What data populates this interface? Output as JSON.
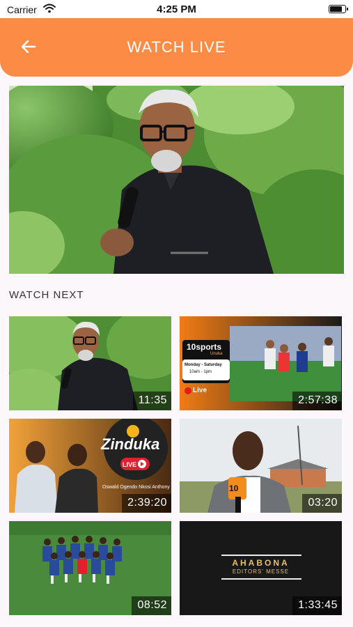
{
  "status": {
    "carrier": "Carrier",
    "time": "4:25 PM",
    "battery_level": 0.9
  },
  "header": {
    "title": "WATCH LIVE"
  },
  "icons": {
    "back": "arrow-left-icon",
    "wifi": "wifi-icon",
    "battery": "battery-icon"
  },
  "colors": {
    "accent": "#fb8b45",
    "background": "#fbf7fa"
  },
  "watch_next": {
    "title": "WATCH NEXT",
    "videos": [
      {
        "duration": "11:35"
      },
      {
        "duration": "2:57:38",
        "brand": "10sports",
        "brand_sub": "Unuka",
        "schedule_days": "Monday - Saturday",
        "schedule_time": "10am - 1pm",
        "live_label": "Live"
      },
      {
        "duration": "2:39:20",
        "show": "Zinduka",
        "live_label": "LIVE",
        "presenters": "Oswald Ogendo  Nkosi Anthony"
      },
      {
        "duration": "03:20",
        "mic_label": "10"
      },
      {
        "duration": "08:52"
      },
      {
        "duration": "1:33:45",
        "caption_line1": "AHABONA",
        "caption_line2": "EDITORS' MESSE"
      }
    ]
  }
}
